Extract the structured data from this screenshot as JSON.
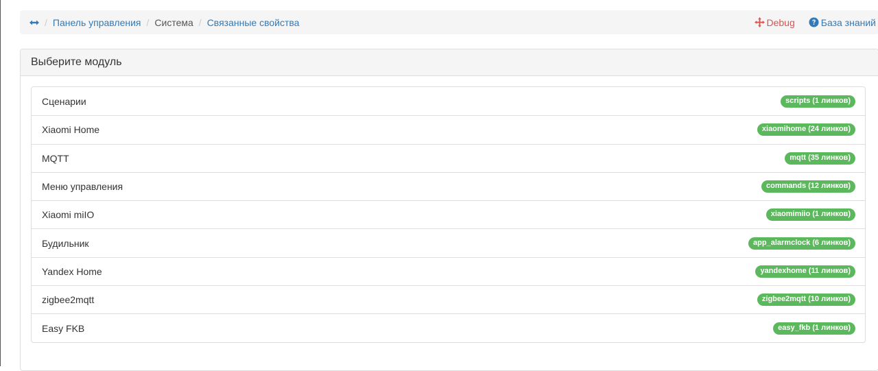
{
  "breadcrumb": {
    "home_icon": "arrows-horizontal-icon",
    "items": [
      {
        "label": "Панель управления",
        "link": true
      },
      {
        "label": "Система",
        "link": false
      },
      {
        "label": "Связанные свойства",
        "link": true
      }
    ]
  },
  "actions": {
    "debug_label": "Debug",
    "debug_icon": "crosshairs-icon",
    "kb_label": "База знаний",
    "kb_icon": "question-circle-icon"
  },
  "panel": {
    "heading": "Выберите модуль"
  },
  "modules": [
    {
      "label": "Сценарии",
      "badge": "scripts (1 линков)"
    },
    {
      "label": "Xiaomi Home",
      "badge": "xiaomihome (24 линков)"
    },
    {
      "label": "MQTT",
      "badge": "mqtt (35 линков)"
    },
    {
      "label": "Меню управления",
      "badge": "commands (12 линков)"
    },
    {
      "label": "Xiaomi miIO",
      "badge": "xiaomimiio (1 линков)"
    },
    {
      "label": "Будильник",
      "badge": "app_alarmclock (6 линков)"
    },
    {
      "label": "Yandex Home",
      "badge": "yandexhome (11 линков)"
    },
    {
      "label": "zigbee2mqtt",
      "badge": "zigbee2mqtt (10 линков)"
    },
    {
      "label": "Easy FKB",
      "badge": "easy_fkb (1 линков)"
    }
  ],
  "colors": {
    "link": "#337ab7",
    "debug": "#d9534f",
    "badge": "#5cb85c"
  }
}
